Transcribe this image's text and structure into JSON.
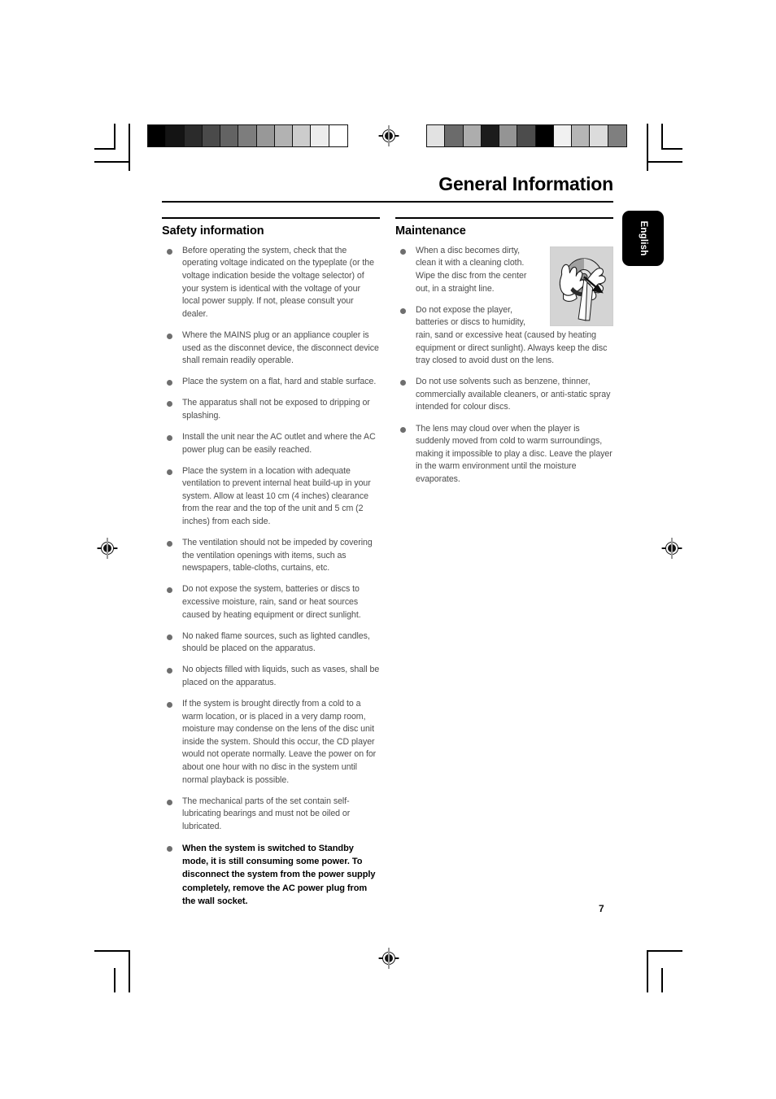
{
  "document": {
    "title": "General Information",
    "page_number": "7",
    "language_tab": "English"
  },
  "calibration": {
    "left_strip": {
      "name": "grayscale-step-wedge",
      "swatches": [
        "#000000",
        "#141414",
        "#2b2b2b",
        "#4a4a4a",
        "#636363",
        "#7d7d7d",
        "#989898",
        "#b2b2b2",
        "#cccccc",
        "#ededed",
        "#ffffff"
      ]
    },
    "right_strip": {
      "name": "random-gray-control-strip",
      "swatches": [
        "#e2e2e2",
        "#6b6b6b",
        "#adadad",
        "#1c1c1c",
        "#949494",
        "#4c4c4c",
        "#000000",
        "#f1f1f1",
        "#b5b5b5",
        "#dcdcdc",
        "#7f7f7f"
      ]
    }
  },
  "columns": {
    "left": {
      "heading": "Safety information",
      "bullets": [
        {
          "text": "Before operating the system, check that the operating voltage indicated on the typeplate (or the voltage indication beside the voltage selector) of your system is identical with the voltage of your local power supply. If not, please consult your dealer.",
          "bold": false
        },
        {
          "text": "Where the MAINS plug or an appliance coupler is used as the disconnet device, the disconnect device shall remain readily operable.",
          "bold": false
        },
        {
          "text": "Place the system on a flat, hard and stable surface.",
          "bold": false
        },
        {
          "text": "The apparatus shall not be exposed to dripping or splashing.",
          "bold": false
        },
        {
          "text": "Install the unit near the AC outlet and where the AC power plug can be easily reached.",
          "bold": false
        },
        {
          "text": "Place the system in a location with adequate ventilation to prevent internal heat build-up in your system.  Allow at least 10 cm (4 inches) clearance from the rear and the top of the unit and 5 cm (2 inches) from each side.",
          "bold": false
        },
        {
          "text": "The ventilation should not be impeded by covering the ventilation openings with items, such as newspapers, table-cloths, curtains, etc.",
          "bold": false
        },
        {
          "text": "Do not expose the system, batteries or discs to excessive moisture, rain, sand or heat sources caused by heating equipment or direct sunlight.",
          "bold": false
        },
        {
          "text": "No naked flame sources, such as lighted candles, should be placed on the apparatus.",
          "bold": false
        },
        {
          "text": "No objects filled with liquids, such as vases, shall be placed on the apparatus.",
          "bold": false
        },
        {
          "text": "If the system is brought directly from a cold to a warm location, or is placed in a very damp room, moisture may condense on the lens of the disc unit inside the system. Should this occur, the CD player would not operate normally. Leave the power on for about one hour with no disc in the system until normal playback is possible.",
          "bold": false
        },
        {
          "text": "The mechanical parts of the set contain self-lubricating bearings and must not be oiled or lubricated.",
          "bold": false
        },
        {
          "text": "When the system is switched to Standby mode, it is still consuming some power. To disconnect the system from the power supply completely, remove the AC power plug from the wall socket.",
          "bold": true
        }
      ]
    },
    "right": {
      "heading": "Maintenance",
      "figure": {
        "name": "disc-cleaning-illustration",
        "description": "Hands holding a compact disc and wiping it from the center outward with a cloth"
      },
      "bullets": [
        {
          "text": "When a disc becomes dirty, clean it with a cleaning cloth. Wipe the disc from the center out, in a straight line.",
          "bold": false
        },
        {
          "text": "Do not expose the player, batteries or discs to humidity, rain, sand or excessive heat (caused by heating equipment or direct sunlight). Always keep the disc tray closed to avoid dust on the lens.",
          "bold": false
        },
        {
          "text": "Do not use solvents such as benzene, thinner, commercially available cleaners, or anti-static spray intended for colour discs.",
          "bold": false
        },
        {
          "text": "The lens may cloud over when the player is suddenly moved from cold to warm surroundings, making it impossible to play a disc. Leave the player in the warm environment until the moisture evaporates.",
          "bold": false
        }
      ]
    }
  }
}
